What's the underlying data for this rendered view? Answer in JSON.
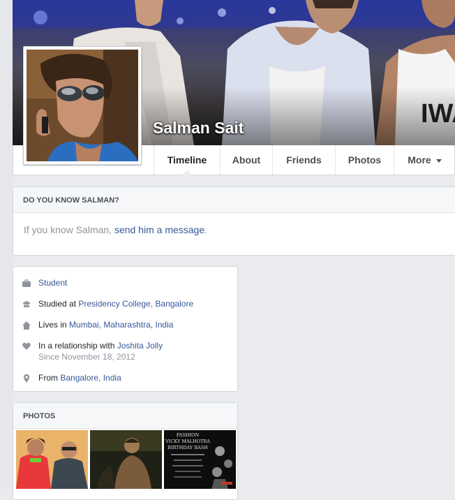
{
  "profile": {
    "name": "Salman Sait"
  },
  "nav": {
    "tabs": [
      {
        "label": "Timeline"
      },
      {
        "label": "About"
      },
      {
        "label": "Friends"
      },
      {
        "label": "Photos"
      },
      {
        "label": "More"
      }
    ]
  },
  "know": {
    "header": "DO YOU KNOW SALMAN?",
    "prefix": "If you know Salman, ",
    "link": "send him a message",
    "suffix": "."
  },
  "about": {
    "work": {
      "link": "Student",
      "icon": "briefcase-icon"
    },
    "education": {
      "prefix": "Studied at ",
      "link": "Presidency College, Bangalore",
      "icon": "graduation-cap-icon"
    },
    "lives": {
      "prefix": "Lives in ",
      "link": "Mumbai, Maharashtra, India",
      "icon": "house-icon"
    },
    "relationship": {
      "prefix": "In a relationship with ",
      "link": "Joshita Jolly",
      "since": "Since November 18, 2012",
      "icon": "heart-icon"
    },
    "from": {
      "prefix": "From ",
      "link": "Bangalore, India",
      "icon": "location-pin-icon"
    }
  },
  "photos": {
    "header": "PHOTOS",
    "poster_lines": [
      "FASHION",
      "VICKY MALHOTRA",
      "BIRTHDAY BASH"
    ]
  },
  "colors": {
    "link": "#365899",
    "background": "#e9ebee",
    "header_text": "#4b4f56"
  }
}
